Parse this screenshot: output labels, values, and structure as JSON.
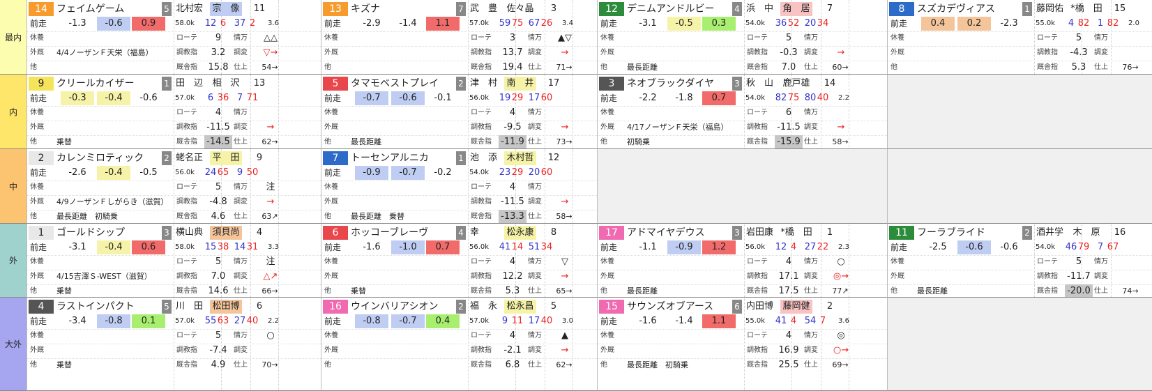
{
  "rows": [
    {
      "label": "最内",
      "color": "#fdfdb0"
    },
    {
      "label": "内",
      "color": "#fde66a"
    },
    {
      "label": "中",
      "color": "#fcc370"
    },
    {
      "label": "外",
      "color": "#9fd1cd"
    },
    {
      "label": "大外",
      "color": "#a5a5f0"
    }
  ],
  "labels": {
    "zensou": "前走",
    "kyuyou": "休養",
    "gaikyu": "外厩",
    "ta": "他",
    "rote": "ローテ",
    "choukyoushi": "調教指",
    "kyuusha": "厩舎指",
    "joukyou": "情万",
    "chouhen": "調変",
    "shiage": "仕上"
  },
  "horses": [
    {
      "row": 0,
      "col": 0,
      "num": "14",
      "numColor": "#f79c2c",
      "name": "フェイムゲーム",
      "waku": "5",
      "jockey": "北村宏",
      "jockey2": "宗　像",
      "j2Color": "#bfcdf3",
      "r": "11",
      "weight": "58.0k",
      "s1": "12",
      "s2": "6",
      "s3": "37",
      "s4": "2",
      "odds": "3.6",
      "z": [
        "-1.3",
        "-0.6",
        "0.9"
      ],
      "zc": [
        "",
        "bl",
        "rd"
      ],
      "kyu": "",
      "gai": "4/4ノーザンＦ天栄（福島）",
      "ta": "",
      "rote": "9",
      "chou": "3.2",
      "kyuu": "15.8",
      "jo": "",
      "chouhen": "",
      "shiage": "",
      "m1": "△△",
      "m2": "▽→",
      "m3": "54→",
      "kyuuC": ""
    },
    {
      "row": 0,
      "col": 1,
      "num": "13",
      "numColor": "#f79c2c",
      "name": "キズナ",
      "waku": "7",
      "jockey": "武　豊",
      "jockey2": "佐々晶",
      "j2Color": "",
      "r": "3",
      "weight": "57.0k",
      "s1": "59",
      "s2": "75",
      "s3": "67",
      "s4": "26",
      "odds": "3.4",
      "z": [
        "-2.9",
        "-1.4",
        "1.1"
      ],
      "zc": [
        "",
        "",
        "rd"
      ],
      "kyu": "",
      "gai": "",
      "ta": "",
      "rote": "3",
      "chou": "13.7",
      "kyuu": "19.4",
      "jo": "",
      "chouhen": "",
      "shiage": "",
      "m1": "▲▽",
      "m2": "→",
      "m3": "71→",
      "kyuuC": ""
    },
    {
      "row": 0,
      "col": 2,
      "num": "12",
      "numColor": "#2c8c3c",
      "name": "デニムアンドルビー",
      "waku": "4",
      "jockey": "浜　中",
      "jockey2": "角　居",
      "j2Color": "#f8c3c3",
      "r": "7",
      "weight": "54.0k",
      "s1": "36",
      "s2": "52",
      "s3": "20",
      "s4": "34",
      "odds": "",
      "z": [
        "-3.1",
        "-0.5",
        "0.3"
      ],
      "zc": [
        "",
        "yl",
        "gn"
      ],
      "kyu": "",
      "gai": "",
      "ta": "最長距離",
      "rote": "5",
      "chou": "-0.3",
      "kyuu": "7.0",
      "jo": "",
      "chouhen": "",
      "shiage": "",
      "m1": "",
      "m2": "→",
      "m3": "60→",
      "kyuuC": ""
    },
    {
      "row": 0,
      "col": 3,
      "num": "8",
      "numColor": "#2c6cc8",
      "name": "スズカデヴィアス",
      "waku": "1",
      "jockey": "藤岡佑",
      "jockey2": "*橋　田",
      "j2Color": "",
      "r": "15",
      "weight": "55.0k",
      "s1": "4",
      "s2": "82",
      "s3": "1",
      "s4": "82",
      "odds": "2.0",
      "z": [
        "0.4",
        "0.2",
        "-2.3"
      ],
      "zc": [
        "or",
        "or",
        ""
      ],
      "kyu": "",
      "gai": "",
      "ta": "",
      "rote": "5",
      "chou": "-4.3",
      "kyuu": "5.3",
      "jo": "",
      "chouhen": "",
      "shiage": "",
      "m1": "",
      "m2": "",
      "m3": "76→",
      "kyuuC": ""
    },
    {
      "row": 1,
      "col": 0,
      "num": "9",
      "numColor": "#f6e35c",
      "name": "クリールカイザー",
      "waku": "1",
      "jockey": "田　辺",
      "jockey2": "相　沢",
      "j2Color": "",
      "r": "13",
      "weight": "57.0k",
      "s1": "6",
      "s2": "36",
      "s3": "7",
      "s4": "71",
      "odds": "",
      "z": [
        "-0.3",
        "-0.4",
        "-0.6"
      ],
      "zc": [
        "yl",
        "yl",
        ""
      ],
      "kyu": "",
      "gai": "",
      "ta": "乗替",
      "rote": "4",
      "chou": "-11.5",
      "kyuu": "-14.5",
      "jo": "",
      "chouhen": "",
      "shiage": "",
      "m1": "",
      "m2": "→",
      "m3": "62→",
      "kyuuC": "gy"
    },
    {
      "row": 1,
      "col": 1,
      "num": "5",
      "numColor": "#e8474c",
      "name": "タマモベストプレイ",
      "waku": "2",
      "jockey": "津　村",
      "jockey2": "南　井",
      "j2Color": "#f6f3a8",
      "r": "17",
      "weight": "56.0k",
      "s1": "19",
      "s2": "29",
      "s3": "17",
      "s4": "60",
      "odds": "",
      "z": [
        "-0.7",
        "-0.6",
        "-0.1"
      ],
      "zc": [
        "bl",
        "bl",
        ""
      ],
      "kyu": "",
      "gai": "",
      "ta": "最長距離",
      "rote": "4",
      "chou": "-9.5",
      "kyuu": "-11.9",
      "jo": "",
      "chouhen": "",
      "shiage": "",
      "m1": "",
      "m2": "→",
      "m3": "73→",
      "kyuuC": "gy"
    },
    {
      "row": 1,
      "col": 2,
      "num": "3",
      "numColor": "#555555",
      "name": "ネオブラックダイヤ",
      "waku": "3",
      "jockey": "秋　山",
      "jockey2": "鹿戸雄",
      "j2Color": "",
      "r": "14",
      "weight": "54.0k",
      "s1": "82",
      "s2": "75",
      "s3": "80",
      "s4": "40",
      "odds": "2.2",
      "z": [
        "-2.2",
        "-1.8",
        "0.7"
      ],
      "zc": [
        "",
        "",
        "rd"
      ],
      "kyu": "",
      "gai": "4/17ノーザンＦ天栄（福島）",
      "ta": "初騎乗",
      "rote": "6",
      "chou": "-11.5",
      "kyuu": "-15.9",
      "jo": "",
      "chouhen": "",
      "shiage": "",
      "m1": "",
      "m2": "→",
      "m3": "58→",
      "kyuuC": "gy"
    },
    {
      "row": 2,
      "col": 0,
      "num": "2",
      "numColor": "#e8e8e8",
      "name": "カレンミロティック",
      "waku": "2",
      "jockey": "蛯名正",
      "jockey2": "平　田",
      "j2Color": "#f6f3a8",
      "r": "9",
      "weight": "56.0k",
      "s1": "24",
      "s2": "65",
      "s3": "9",
      "s4": "50",
      "odds": "",
      "z": [
        "-2.6",
        "-0.4",
        "-0.5"
      ],
      "zc": [
        "",
        "yl",
        ""
      ],
      "kyu": "",
      "gai": "4/9ノーザンＦしがらき（滋賀）",
      "ta": "最長距離　初騎乗",
      "rote": "5",
      "chou": "-4.8",
      "kyuu": "4.6",
      "jo": "",
      "chouhen": "",
      "shiage": "",
      "m1": "注",
      "m2": "→",
      "m3": "63↗",
      "kyuuC": ""
    },
    {
      "row": 2,
      "col": 1,
      "num": "7",
      "numColor": "#2c6cc8",
      "name": "トーセンアルニカ",
      "waku": "1",
      "jockey": "池　添",
      "jockey2": "木村哲",
      "j2Color": "#f6f3a8",
      "r": "12",
      "weight": "54.0k",
      "s1": "23",
      "s2": "29",
      "s3": "20",
      "s4": "60",
      "odds": "",
      "z": [
        "-0.9",
        "-0.7",
        "-0.2"
      ],
      "zc": [
        "bl",
        "bl",
        ""
      ],
      "kyu": "",
      "gai": "",
      "ta": "最長距離　乗替",
      "rote": "4",
      "chou": "-11.5",
      "kyuu": "-13.3",
      "jo": "",
      "chouhen": "",
      "shiage": "",
      "m1": "",
      "m2": "→",
      "m3": "58→",
      "kyuuC": "gy"
    },
    {
      "row": 3,
      "col": 0,
      "num": "1",
      "numColor": "#e8e8e8",
      "name": "ゴールドシップ",
      "waku": "3",
      "jockey": "横山典",
      "jockey2": "須貝尚",
      "j2Color": "#f4c59a",
      "r": "4",
      "weight": "58.0k",
      "s1": "15",
      "s2": "38",
      "s3": "14",
      "s4": "31",
      "odds": "3.3",
      "z": [
        "-3.1",
        "-0.4",
        "0.6"
      ],
      "zc": [
        "",
        "yl",
        "rd"
      ],
      "kyu": "",
      "gai": "4/15吉澤Ｓ-WEST（滋賀）",
      "ta": "乗替",
      "rote": "5",
      "chou": "7.0",
      "kyuu": "14.6",
      "jo": "",
      "chouhen": "",
      "shiage": "",
      "m1": "注",
      "m2": "△↗",
      "m3": "66→",
      "kyuuC": ""
    },
    {
      "row": 3,
      "col": 1,
      "num": "6",
      "numColor": "#e8474c",
      "name": "ホッコーブレーヴ",
      "waku": "4",
      "jockey": "幸",
      "jockey2": "松永康",
      "j2Color": "#f6f3a8",
      "r": "8",
      "weight": "56.0k",
      "s1": "41",
      "s2": "14",
      "s3": "51",
      "s4": "34",
      "odds": "",
      "z": [
        "-1.6",
        "-1.0",
        "0.7"
      ],
      "zc": [
        "",
        "bl",
        "rd"
      ],
      "kyu": "",
      "gai": "",
      "ta": "乗替",
      "rote": "4",
      "chou": "12.2",
      "kyuu": "5.3",
      "jo": "",
      "chouhen": "",
      "shiage": "",
      "m1": "▽",
      "m2": "→",
      "m3": "65→",
      "kyuuC": ""
    },
    {
      "row": 3,
      "col": 2,
      "num": "17",
      "numColor": "#ef6ab0",
      "name": "アドマイヤデウス",
      "waku": "3",
      "jockey": "岩田康",
      "jockey2": "*橋　田",
      "j2Color": "",
      "r": "1",
      "weight": "56.0k",
      "s1": "12",
      "s2": "4",
      "s3": "27",
      "s4": "22",
      "odds": "2.3",
      "z": [
        "-1.1",
        "-0.9",
        "1.2"
      ],
      "zc": [
        "",
        "bl",
        "rd"
      ],
      "kyu": "",
      "gai": "",
      "ta": "最長距離",
      "rote": "4",
      "chou": "17.1",
      "kyuu": "17.5",
      "jo": "",
      "chouhen": "",
      "shiage": "",
      "m1": "○",
      "m2": "◎→",
      "m3": "77↗",
      "kyuuC": ""
    },
    {
      "row": 3,
      "col": 3,
      "num": "11",
      "numColor": "#2c8c3c",
      "name": "フーラブライド",
      "waku": "2",
      "jockey": "酒井学",
      "jockey2": "木　原",
      "j2Color": "",
      "r": "16",
      "weight": "54.0k",
      "s1": "46",
      "s2": "79",
      "s3": "7",
      "s4": "67",
      "odds": "",
      "z": [
        "-2.5",
        "-0.6",
        "-0.6"
      ],
      "zc": [
        "",
        "bl",
        ""
      ],
      "kyu": "",
      "gai": "",
      "ta": "最長距離",
      "rote": "5",
      "chou": "-11.7",
      "kyuu": "-20.0",
      "jo": "",
      "chouhen": "",
      "shiage": "",
      "m1": "",
      "m2": "",
      "m3": "74→",
      "kyuuC": "gy"
    },
    {
      "row": 4,
      "col": 0,
      "num": "4",
      "numColor": "#555555",
      "name": "ラストインパクト",
      "waku": "5",
      "jockey": "川　田",
      "jockey2": "松田博",
      "j2Color": "#f4c59a",
      "r": "6",
      "weight": "57.0k",
      "s1": "55",
      "s2": "63",
      "s3": "27",
      "s4": "40",
      "odds": "2.2",
      "z": [
        "-3.4",
        "-0.8",
        "0.1"
      ],
      "zc": [
        "",
        "bl",
        "gn"
      ],
      "kyu": "",
      "gai": "",
      "ta": "乗替",
      "rote": "5",
      "chou": "-7.4",
      "kyuu": "4.9",
      "jo": "",
      "chouhen": "",
      "shiage": "",
      "m1": "○",
      "m2": "",
      "m3": "70→",
      "kyuuC": ""
    },
    {
      "row": 4,
      "col": 1,
      "num": "16",
      "numColor": "#ef6ab0",
      "name": "ウインバリアシオン",
      "waku": "2",
      "jockey": "福　永",
      "jockey2": "松永昌",
      "j2Color": "#f6f3a8",
      "r": "5",
      "weight": "57.0k",
      "s1": "9",
      "s2": "11",
      "s3": "17",
      "s4": "40",
      "odds": "3.0",
      "z": [
        "-0.8",
        "-0.7",
        "0.4"
      ],
      "zc": [
        "bl",
        "bl",
        "gn"
      ],
      "kyu": "",
      "gai": "",
      "ta": "",
      "rote": "4",
      "chou": "-2.1",
      "kyuu": "6.8",
      "jo": "",
      "chouhen": "",
      "shiage": "",
      "m1": "▲",
      "m2": "→",
      "m3": "62→",
      "kyuuC": ""
    },
    {
      "row": 4,
      "col": 2,
      "num": "15",
      "numColor": "#ef6ab0",
      "name": "サウンズオブアース",
      "waku": "6",
      "jockey": "内田博",
      "jockey2": "藤岡健",
      "j2Color": "#f8c3c3",
      "r": "2",
      "weight": "55.0k",
      "s1": "41",
      "s2": "4",
      "s3": "54",
      "s4": "7",
      "odds": "3.6",
      "z": [
        "-1.6",
        "-1.4",
        "1.1"
      ],
      "zc": [
        "",
        "",
        "rd"
      ],
      "kyu": "",
      "gai": "",
      "ta": "最長距離　初騎乗",
      "rote": "4",
      "chou": "16.9",
      "kyuu": "25.5",
      "jo": "",
      "chouhen": "",
      "shiage": "",
      "m1": "◎",
      "m2": "○→",
      "m3": "69→",
      "kyuuC": ""
    }
  ]
}
